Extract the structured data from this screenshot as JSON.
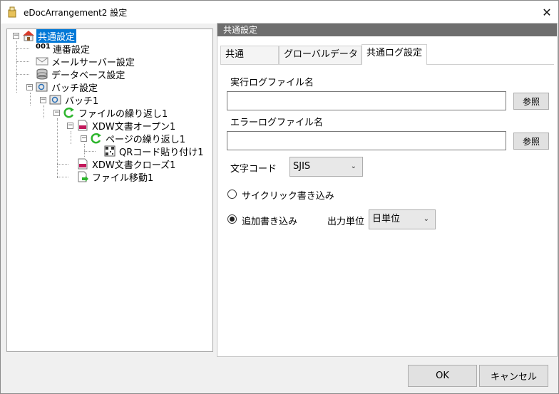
{
  "window": {
    "title": "eDocArrangement2 設定",
    "close_glyph": "✕"
  },
  "tree": {
    "items": [
      {
        "label": "共通設定",
        "icon": "house-icon",
        "selected": true
      },
      {
        "label": "連番設定",
        "icon": "number-001-icon",
        "icon_text": "001"
      },
      {
        "label": "メールサーバー設定",
        "icon": "envelope-icon"
      },
      {
        "label": "データベース設定",
        "icon": "database-icon"
      },
      {
        "label": "バッチ設定",
        "icon": "batch-settings-icon"
      },
      {
        "label": "バッチ1",
        "icon": "batch-icon"
      },
      {
        "label": "ファイルの繰り返し1",
        "icon": "loop-icon"
      },
      {
        "label": "XDW文書オープン1",
        "icon": "xdw-document-icon"
      },
      {
        "label": "ページの繰り返し1",
        "icon": "loop-icon"
      },
      {
        "label": "QRコード貼り付け1",
        "icon": "qr-code-icon"
      },
      {
        "label": "XDW文書クローズ1",
        "icon": "xdw-document-icon"
      },
      {
        "label": "ファイル移動1",
        "icon": "file-move-icon"
      }
    ]
  },
  "panel": {
    "header": "共通設定",
    "tabs": [
      {
        "label": "共通",
        "active": false
      },
      {
        "label": "グローバルデータ",
        "active": false
      },
      {
        "label": "共通ログ設定",
        "active": true
      }
    ],
    "exec_log_label": "実行ログファイル名",
    "exec_log_value": "",
    "error_log_label": "エラーログファイル名",
    "error_log_value": "",
    "browse_label": "参照",
    "charset_label": "文字コード",
    "charset_value": "SJIS",
    "cyclic_label": "サイクリック書き込み",
    "cyclic_checked": false,
    "append_label": "追加書き込み",
    "append_checked": true,
    "unit_label": "出力単位",
    "unit_value": "日単位"
  },
  "footer": {
    "ok_label": "OK",
    "cancel_label": "キャンセル"
  },
  "colors": {
    "selection": "#0078d7",
    "header_bg": "#6e6e6e",
    "loop_green": "#2db52d",
    "house_red": "#d93a2b"
  }
}
